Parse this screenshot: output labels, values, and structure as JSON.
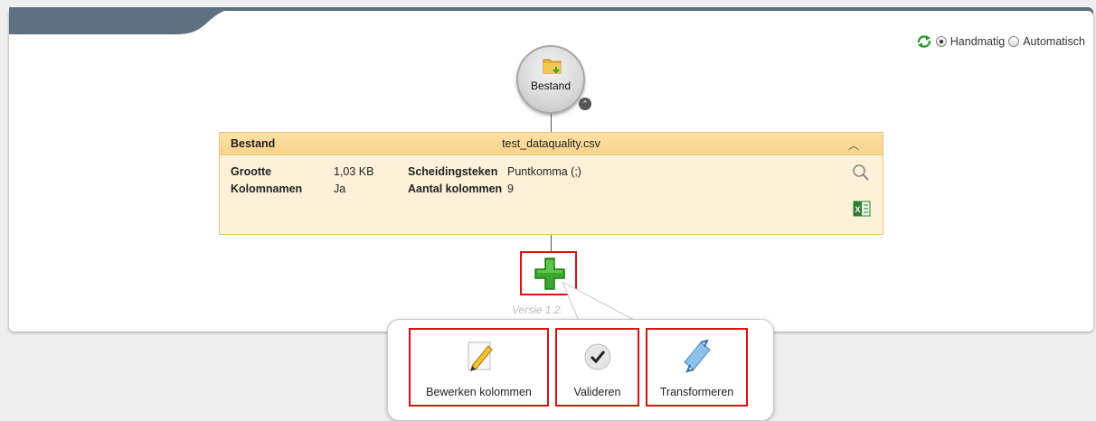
{
  "mode": {
    "manual_label": "Handmatig",
    "automatic_label": "Automatisch",
    "selected": "Handmatig"
  },
  "node": {
    "label": "Bestand"
  },
  "info": {
    "title": "Bestand",
    "filename": "test_dataquality.csv",
    "rows": [
      {
        "label1": "Grootte",
        "value1": "1,03 KB",
        "label2": "Scheidingsteken",
        "value2": "Puntkomma (;)"
      },
      {
        "label1": "Kolomnamen",
        "value1": "Ja",
        "label2": "Aantal kolommen",
        "value2": "9"
      }
    ]
  },
  "version": "Versie 1.2.",
  "actions": {
    "edit_label": "Bewerken kolommen",
    "validate_label": "Valideren",
    "transform_label": "Transformeren"
  },
  "colors": {
    "header_band": "#5f7080",
    "info_bg": "#fdf2d9",
    "highlight": "#e01010",
    "plus_green": "#3aa62b"
  },
  "icons": [
    "refresh-icon",
    "folder-icon",
    "collapse-icon",
    "magnifier-icon",
    "excel-icon",
    "plus-icon",
    "pencil-icon",
    "checkmark-icon",
    "transform-icon"
  ]
}
